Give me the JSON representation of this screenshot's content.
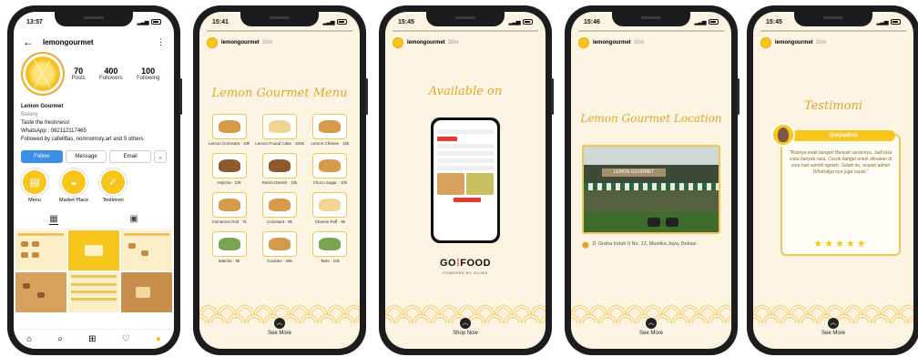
{
  "status_times": [
    "13:57",
    "15:41",
    "15:45",
    "15:46",
    "15:45"
  ],
  "colors": {
    "accent": "#f7c51c",
    "script_title": "#e0a62b",
    "follow_button": "#3b8fe8",
    "gofood_red": "#e8372f"
  },
  "profile": {
    "username": "lemongourmet",
    "posts": "70",
    "posts_label": "Posts",
    "followers": "400",
    "followers_label": "Followers",
    "following": "100",
    "following_label": "Following",
    "name": "Lemon Gourmet",
    "category": "Bakery",
    "tagline": "Taste the freshness!",
    "whatsapp": "WhatsApp : 082112117465",
    "followed_by": "Followed by cafeliftas, nomnomsly.art and 5 others",
    "follow_btn": "Follow",
    "message_btn": "Message",
    "email_btn": "Email",
    "highlights": [
      {
        "label": "Menu",
        "icon": "menu-icon"
      },
      {
        "label": "Market Place",
        "icon": "basket-icon"
      },
      {
        "label": "Testimoni",
        "icon": "check-icon"
      }
    ]
  },
  "story_user": {
    "name": "lemongourmet",
    "time": "30m"
  },
  "menu_screen": {
    "title": "Lemon Gourmet Menu",
    "items": [
      "Lemon Croissant · 10k",
      "Lemon Pound Cake · 100k",
      "Lemon Cheese · 15k",
      "Hojicha · 10k",
      "Raisin Danish · 10k",
      "Choco Sugar · 10k",
      "Cinnamon Roll · 7k",
      "Croissant · 9k",
      "Cheese Puff · 9k",
      "Matcha · 9k",
      "Cookies · 25k",
      "Tarts · 10k"
    ],
    "see_more": "See More"
  },
  "gofood_screen": {
    "title": "Available on",
    "brand_prefix": "GO",
    "brand_suffix": "FOOD",
    "brand_sub": "POWERED BY GOJEK",
    "shop_now": "Shop Now"
  },
  "location_screen": {
    "title": "Lemon Gourmet Location",
    "sign": "LEMON GOURMET",
    "address": "Jl. Graha Indah II No. 12, Mustika Jaya, Bekasi",
    "see_more": "See More"
  },
  "testimoni_screen": {
    "title": "Testimoni",
    "handle": "@alyaafres",
    "quote": "\"Rotinya enak banget! Banyak variannya. Jadi bisa coba banyak rasa. Cocok banget untuk dimakan di sore hari sambil ngeteh. Selain itu, respon admin WhatsApp nya juga cepat.\"",
    "stars": "★★★★★",
    "rating": 5,
    "see_more": "See More"
  }
}
